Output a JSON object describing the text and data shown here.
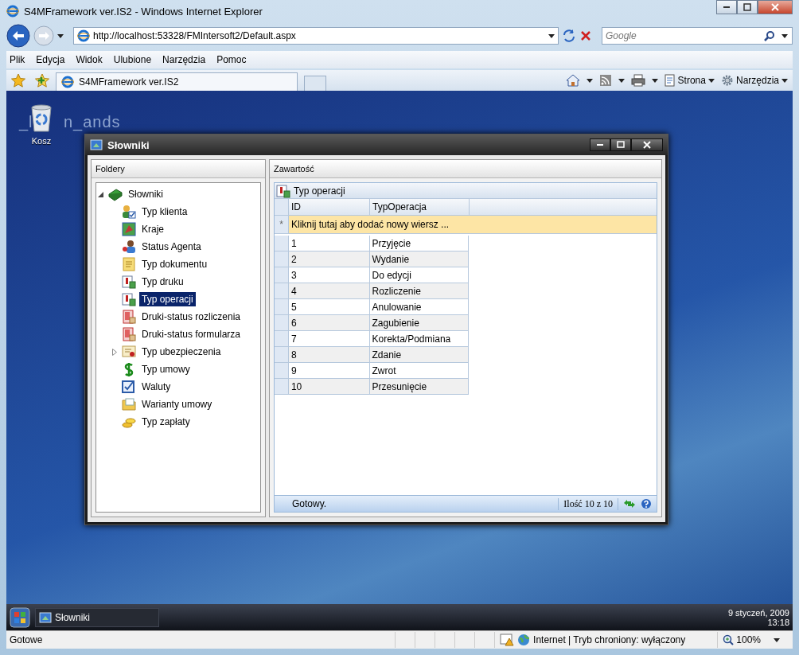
{
  "browser": {
    "title": "S4MFramework ver.IS2 - Windows Internet Explorer",
    "address": "http://localhost:53328/FMIntersoft2/Default.aspx",
    "search_placeholder": "Google",
    "menu": [
      "Plik",
      "Edycja",
      "Widok",
      "Ulubione",
      "Narzędzia",
      "Pomoc"
    ],
    "tabs": [
      {
        "label": "S4MFramework ver.IS2",
        "selected": true
      }
    ],
    "commands": [
      "Strona",
      "Narzędzia"
    ],
    "status": {
      "text": "Gotowe",
      "zone": "Internet | Tryb chroniony: wyłączony",
      "zoom": "100%"
    }
  },
  "desktop": {
    "wallpaper_text": [
      "_l",
      "n_ands"
    ],
    "icons": [
      {
        "label": "Kosz"
      }
    ]
  },
  "window": {
    "title": "Słowniki",
    "folders_header": "Foldery",
    "tree": [
      {
        "label": "Słowniki",
        "expanded": true,
        "selected": false,
        "children": [
          {
            "label": "Typ klienta",
            "selected": false
          },
          {
            "label": "Kraje",
            "selected": false
          },
          {
            "label": "Status Agenta",
            "selected": false
          },
          {
            "label": "Typ dokumentu",
            "selected": false
          },
          {
            "label": "Typ druku",
            "selected": false
          },
          {
            "label": "Typ operacji",
            "selected": true
          },
          {
            "label": "Druki-status rozliczenia",
            "selected": false
          },
          {
            "label": "Druki-status formularza",
            "selected": false
          },
          {
            "label": "Typ ubezpieczenia",
            "expanded": false,
            "selected": false
          },
          {
            "label": "Typ umowy",
            "selected": false
          },
          {
            "label": "Waluty",
            "selected": false
          },
          {
            "label": "Warianty umowy",
            "selected": false
          },
          {
            "label": "Typ zapłaty",
            "selected": false
          }
        ]
      }
    ],
    "content_header": "Zawartość",
    "grid": {
      "title": "Typ operacji",
      "columns": [
        "ID",
        "TypOperacja"
      ],
      "new_row": "Kliknij tutaj aby dodać nowy wiersz ...",
      "new_row_marker": "*",
      "rows": [
        {
          "id": "1",
          "name": "Przyjęcie"
        },
        {
          "id": "2",
          "name": "Wydanie"
        },
        {
          "id": "3",
          "name": "Do edycji"
        },
        {
          "id": "4",
          "name": "Rozliczenie"
        },
        {
          "id": "5",
          "name": "Anulowanie"
        },
        {
          "id": "6",
          "name": "Zagubienie"
        },
        {
          "id": "7",
          "name": "Korekta/Podmiana"
        },
        {
          "id": "8",
          "name": "Zdanie"
        },
        {
          "id": "9",
          "name": "Zwrot"
        },
        {
          "id": "10",
          "name": "Przesunięcie"
        }
      ],
      "status": "Gotowy.",
      "count": "Ilość 10 z 10"
    }
  },
  "taskbar": {
    "items": [
      {
        "label": "Słowniki"
      }
    ],
    "date": "9 styczeń, 2009",
    "time": "13:18"
  }
}
